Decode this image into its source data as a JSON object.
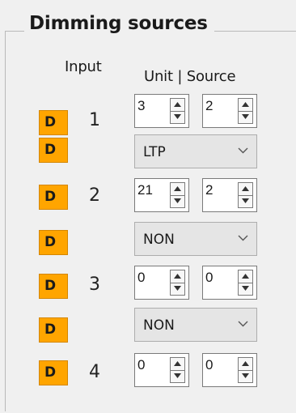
{
  "group": {
    "title": "Dimming sources"
  },
  "headers": {
    "input": "Input",
    "unit_source": "Unit | Source"
  },
  "rows": [
    {
      "d_label": "D",
      "input_number": "1",
      "unit": "3",
      "source": "2"
    },
    {
      "d_label": "D",
      "dropdown": "LTP"
    },
    {
      "d_label": "D",
      "input_number": "2",
      "unit": "21",
      "source": "2"
    },
    {
      "d_label": "D",
      "dropdown": "NON"
    },
    {
      "d_label": "D",
      "input_number": "3",
      "unit": "0",
      "source": "0"
    },
    {
      "d_label": "D",
      "dropdown": "NON"
    },
    {
      "d_label": "D",
      "input_number": "4",
      "unit": "0",
      "source": "0"
    }
  ],
  "icons": {
    "spin_up": "triangle-up-icon",
    "spin_down": "triangle-down-icon",
    "dropdown": "chevron-down-icon"
  },
  "colors": {
    "d_button": "#ffa500",
    "background": "#f0f0f0"
  }
}
